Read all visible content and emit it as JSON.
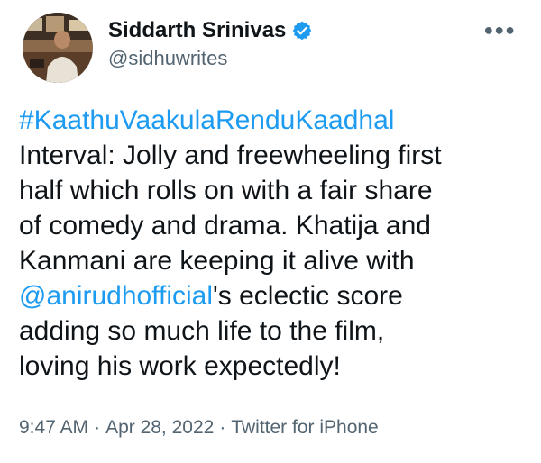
{
  "author": {
    "name": "Siddarth Srinivas",
    "handle": "@sidhuwrites",
    "verified": true
  },
  "tweet": {
    "hashtag": "#KaathuVaakulaRenduKaadhal",
    "line2": "Interval: Jolly and freewheeling first",
    "line3": "half which rolls on with a fair share",
    "line4": "of comedy and drama. Khatija and",
    "line5": "Kanmani are keeping it alive with",
    "mention": "@anirudhofficial",
    "line6_rest": "'s eclectic score",
    "line7": "adding so much life to the film,",
    "line8": "loving his work expectedly!"
  },
  "meta": {
    "time": "9:47 AM",
    "date": "Apr 28, 2022",
    "source": "Twitter for iPhone",
    "separator": "·"
  },
  "icons": {
    "more": "more-horizontal-icon",
    "verified": "verified-badge-icon"
  },
  "colors": {
    "link": "#1d9bf0",
    "secondary_text": "#536471",
    "primary_text": "#0f1419"
  }
}
